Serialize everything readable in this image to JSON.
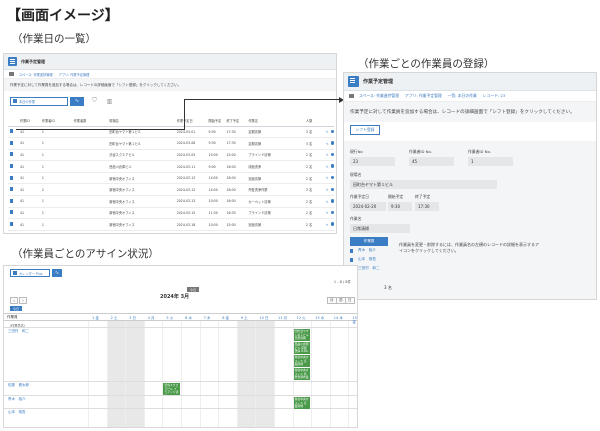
{
  "page_title": "【画面イメージ】",
  "sections": {
    "list": "（作業日の一覧）",
    "register": "（作業ごとの作業員の登録）",
    "assign": "（作業員ごとのアサイン状況）"
  },
  "app": {
    "name": "作業予定管理",
    "crumbs": [
      "スペース: 作業進捗管理",
      "アプリ: 作業予定管理",
      "一覧: 本日の作業"
    ]
  },
  "list_panel": {
    "notice": "作業予定に対して作業員を追加する場合は、レコードの詳細画面で「シフト登録」をクリックしてください。",
    "view_name": "本日の作業",
    "columns": [
      "作業ID",
      "作業者ID",
      "作業者数",
      "現場名",
      "作業予定日",
      "開始予定",
      "終了予定",
      "作業名",
      "人数"
    ],
    "rows": [
      [
        "41",
        "1",
        "",
        "田町台ヤマト第１ビル",
        "2024-03-01",
        "9:30",
        "17:30",
        "定期清掃",
        "3 名"
      ],
      [
        "41",
        "1",
        "",
        "田町台ヤマト第１ビル",
        "2024-03-08",
        "9:30",
        "17:30",
        "定期清掃",
        "3 名"
      ],
      [
        "41",
        "1",
        "",
        "渋谷スクエアビル",
        "2024-03-05",
        "10:00",
        "15:00",
        "ブラインド清掃",
        "2 名"
      ],
      [
        "41",
        "1",
        "",
        "西品川倉庫ビル",
        "2024-03-11",
        "9:00",
        "16:00",
        "床面洗浄",
        "2 名"
      ],
      [
        "41",
        "1",
        "",
        "新宿中央オフィス",
        "2024-03-13",
        "14:00",
        "18:00",
        "窓面清掃",
        "2 名"
      ],
      [
        "41",
        "2",
        "",
        "新宿中央オフィス",
        "2024-03-12",
        "14:00",
        "18:00",
        "外壁洗浄作業",
        "3 名"
      ],
      [
        "41",
        "1",
        "",
        "新宿中央オフィス",
        "2024-03-13",
        "10:00",
        "16:00",
        "カーペット清掃",
        "2 名"
      ],
      [
        "41",
        "1",
        "",
        "新宿中央オフィス",
        "2024-03-15",
        "11:30",
        "16:30",
        "ブラインド清掃",
        "2 名"
      ],
      [
        "41",
        "1",
        "",
        "新宿中央オフィス",
        "2024-03-18",
        "10:00",
        "15:00",
        "窓面清掃",
        "2 名"
      ]
    ]
  },
  "register_panel": {
    "crumbs": [
      "スペース: 作業進捗管理",
      "アプリ: 作業予定管理",
      "一覧: 本日の作業",
      "レコード: 23"
    ],
    "notice": "作業予定に対して作業員を追加する場合は、レコードの詳細画面で「シフト登録」をクリックしてください。",
    "shift_button": "シフト登録",
    "fields": {
      "record_id_label": "現行No",
      "record_id": "23",
      "worker_id_label": "作業者ID No.",
      "worker_id": "45",
      "worker_count_label": "作業者ID No.",
      "worker_count": "1",
      "site_label": "現場名",
      "site": "田町台ヤマト第１ビル",
      "date_label": "作業予定日",
      "date": "2024-02-20",
      "start_label": "開始予定",
      "start": "9:30",
      "end_label": "終了予定",
      "end": "17:30",
      "task_label": "作業名",
      "task": "日常清掃"
    },
    "sub_header": "作業員",
    "workers": [
      "青木　裕介",
      "山本　慎吾",
      "三田村　和二"
    ],
    "sub_note": "作業員を変更・削除するには、作業員名の左横のレコードの詳細を表示するアイコンをクリックしてください。",
    "count": "3 名"
  },
  "assign_panel": {
    "view_name": "カレンダー Plus",
    "month_title": "2024年 3月",
    "badge": "今日",
    "today_btn": "今日",
    "pager": "1 - 8 / 8件",
    "view_buttons": [
      "月",
      "週",
      "日"
    ],
    "row_header": "作業員",
    "sub_header": "（作業員名）",
    "days": [
      "1 金",
      "2 土",
      "3 日",
      "4 月",
      "5 火",
      "6 水",
      "7 木",
      "8 金",
      "9 土",
      "10 日",
      "11 月",
      "12 火",
      "13 水",
      "14 木",
      "15 金"
    ],
    "weekend_days": [
      1,
      2,
      8,
      9
    ],
    "lanes": [
      "三田村　和二",
      "佐藤　健太郎",
      "青木　裕介",
      "山本　慎吾"
    ],
    "events": [
      {
        "lane": 0,
        "day": 11,
        "text": "田町台ヤマト第１ビル 日常清掃 9:30-17:30"
      },
      {
        "lane": 0,
        "day": 11,
        "text": "西品川倉庫ビル 床面洗浄 9:00-16:00"
      },
      {
        "lane": 0,
        "day": 11,
        "text": "新宿中央オフィス 窓面清掃 14:00-18:00"
      },
      {
        "lane": 0,
        "day": 11,
        "text": "新宿中央オフィス 外壁洗浄作業 14:00"
      },
      {
        "lane": 1,
        "day": 4,
        "text": "渋谷スクエアビル ブラインド清掃 10:00-15:00"
      },
      {
        "lane": 2,
        "day": 11,
        "text": "新宿中央オフィス 窓面清掃 10:00-15:00"
      }
    ]
  }
}
